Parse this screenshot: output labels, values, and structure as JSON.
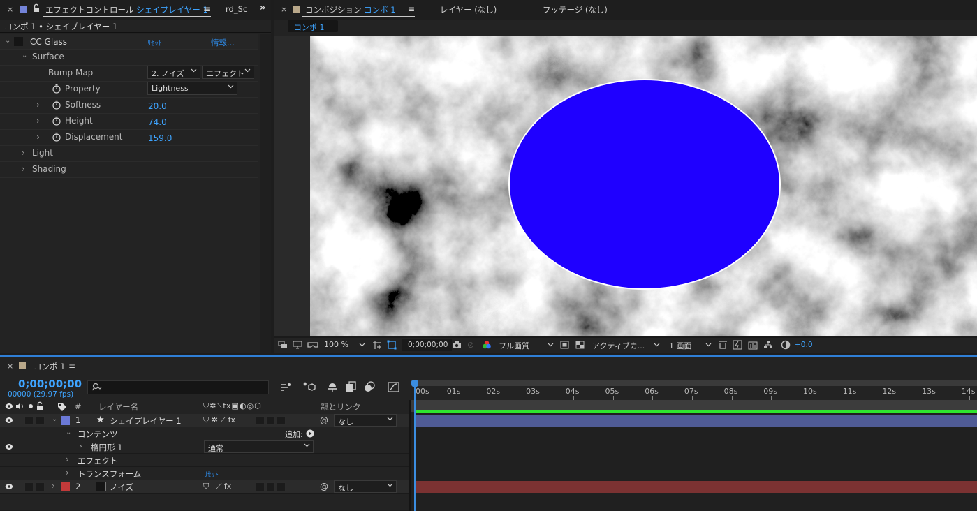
{
  "effect_controls": {
    "tab_label": "エフェクトコントロール",
    "tab_layer": "シェイプレイヤー 1",
    "tab2_label": "rd_Sc",
    "subtitle": "コンポ 1 • シェイプレイヤー 1",
    "effect_name": "CC Glass",
    "reset": "ﾘｾｯﾄ",
    "info": "情報...",
    "group_surface": "Surface",
    "bump_map_label": "Bump Map",
    "bump_map_layer": "2. ノイズ",
    "bump_map_source": "エフェクト",
    "property_label": "Property",
    "property_value": "Lightness",
    "softness_label": "Softness",
    "softness_value": "20.0",
    "height_label": "Height",
    "height_value": "74.0",
    "displacement_label": "Displacement",
    "displacement_value": "159.0",
    "group_light": "Light",
    "group_shading": "Shading"
  },
  "composition": {
    "tab_label": "コンポジション",
    "tab_comp": "コンポ 1",
    "tab_layer": "レイヤー (なし)",
    "tab_footage": "フッテージ (なし)",
    "breadcrumb": "コンポ 1",
    "ellipse_color": "#1f00ff",
    "footer": {
      "zoom": "100 %",
      "timecode": "0;00;00;00",
      "quality": "フル画質",
      "camera": "アクティブカ...",
      "views": "1 画面",
      "exposure": "+0.0"
    }
  },
  "timeline": {
    "tab_label": "コンポ 1",
    "timecode": "0;00;00;00",
    "frame_info": "00000 (29.97 fps)",
    "search_placeholder": "",
    "col_hash": "#",
    "col_layer_name": "レイヤー名",
    "col_parent": "親とリンク",
    "ruler": [
      "00s",
      "01s",
      "02s",
      "03s",
      "04s",
      "05s",
      "06s",
      "07s",
      "08s",
      "09s",
      "10s",
      "11s",
      "12s",
      "13s",
      "14s"
    ],
    "layers": [
      {
        "num": "1",
        "name": "シェイプレイヤー 1",
        "label_color": "#6b79d6",
        "parent": "なし"
      },
      {
        "num": "2",
        "name": "ノイズ",
        "label_color": "#c23a3a",
        "parent": "なし"
      }
    ],
    "contents_label": "コンテンツ",
    "add_label": "追加:",
    "ellipse_group": "楕円形 1",
    "blend_mode": "通常",
    "effects_label": "エフェクト",
    "transform_label": "トランスフォーム",
    "transform_reset": "ﾘｾｯﾄ"
  }
}
